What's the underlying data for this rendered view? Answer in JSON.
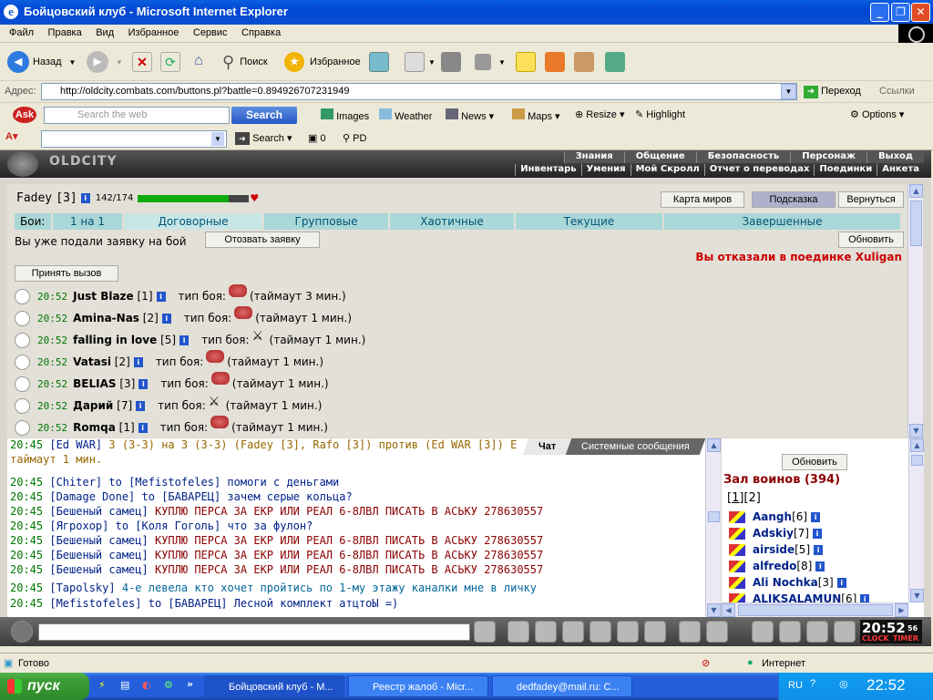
{
  "window": {
    "title": "Бойцовский клуб - Microsoft Internet Explorer"
  },
  "menu": [
    "Файл",
    "Правка",
    "Вид",
    "Избранное",
    "Сервис",
    "Справка"
  ],
  "toolbar": {
    "back": "Назад",
    "search": "Поиск",
    "favorites": "Избранное"
  },
  "address": {
    "label": "Адрес:",
    "url": "http://oldcity.combats.com/buttons.pl?battle=0.894926707231949",
    "go": "Переход",
    "links": "Ссылки"
  },
  "ask": {
    "placeholder": "Search the web",
    "search_btn": "Search",
    "images": "Images",
    "weather": "Weather",
    "news": "News",
    "maps": "Maps",
    "resize": "Resize",
    "highlight": "Highlight",
    "options": "Options",
    "search2": "Search",
    "count": "0",
    "pd": "PD"
  },
  "game": {
    "logo": "OLDCITY",
    "nav_top": [
      "Знания",
      "Общение",
      "Безопасность",
      "Персонаж",
      "Выход"
    ],
    "nav_bottom": [
      "Инвентарь",
      "Умения",
      "Мой Скролл",
      "Отчет о переводах",
      "Поединки",
      "Анкета"
    ],
    "player": {
      "name": "Fadey",
      "level": "[3]",
      "hp": "142/174",
      "hp_fraction": 0.816
    },
    "buttons": {
      "map": "Карта миров",
      "hint": "Подсказка",
      "back": "Вернуться",
      "refresh": "Обновить",
      "withdraw": "Отозвать заявку",
      "accept": "Принять вызов"
    },
    "tabs_label": "Бои:",
    "tabs": [
      "1 на 1",
      "Договорные",
      "Групповые",
      "Хаотичные",
      "Текущие",
      "Завершенные"
    ],
    "submitted": "Вы уже подали заявку на бой",
    "refused": "Вы отказали в поединке Xuligan",
    "fights": [
      {
        "time": "20:52",
        "name": "Just Blaze",
        "level": "[1]",
        "label": "тип боя:",
        "icon": "fist",
        "timeout": "(таймаут 3 мин.)"
      },
      {
        "time": "20:52",
        "name": "Amina-Nas",
        "level": "[2]",
        "label": "тип боя:",
        "icon": "fist",
        "timeout": "(таймаут 1 мин.)"
      },
      {
        "time": "20:52",
        "name": "falling in love",
        "level": "[5]",
        "label": "тип боя:",
        "icon": "swords",
        "timeout": "(таймаут 1 мин.)"
      },
      {
        "time": "20:52",
        "name": "Vatasi",
        "level": "[2]",
        "label": "тип боя:",
        "icon": "fist",
        "timeout": "(таймаут 1 мин.)"
      },
      {
        "time": "20:52",
        "name": "BELIAS",
        "level": "[3]",
        "label": "тип боя:",
        "icon": "fist",
        "timeout": "(таймаут 1 мин.)"
      },
      {
        "time": "20:52",
        "name": "Дарий",
        "level": "[7]",
        "label": "тип боя:",
        "icon": "swords",
        "timeout": "(таймаут 1 мин.)"
      },
      {
        "time": "20:52",
        "name": "Romqa",
        "level": "[1]",
        "label": "тип боя:",
        "icon": "fist",
        "timeout": "(таймаут 1 мин.)"
      }
    ]
  },
  "chat": {
    "tabs": [
      "Чат",
      "Системные сообщения"
    ],
    "lines": [
      {
        "time": "20:45",
        "name": "[Ed WAR]",
        "text": "3 (3-3) на 3 (3-3) (Fadey [3], Rafo [3]) против (Ed WAR [3]) E"
      },
      {
        "time": "",
        "name": "",
        "text": "таймаут 1 мин."
      },
      {
        "time": "20:45",
        "name": "[Chiter]",
        "text": "to [Mefistofeles] помоги с деньгами"
      },
      {
        "time": "20:45",
        "name": "[Damage Done]",
        "text": "to [БАВАРЕЦ] зачем серые кольца?"
      },
      {
        "time": "20:45",
        "name": "[Бешеный самец]",
        "text": "КУПЛЮ ПЕРСА ЗА ЕКР ИЛИ РЕАЛ 6-8ЛВЛ ПИСАТЬ В АСЬКУ 278630557"
      },
      {
        "time": "20:45",
        "name": "[Ягрохор]",
        "text": "to [Коля Гоголь] что за фулон?"
      },
      {
        "time": "20:45",
        "name": "[Бешеный самец]",
        "text": "КУПЛЮ ПЕРСА ЗА ЕКР ИЛИ РЕАЛ 6-8ЛВЛ ПИСАТЬ В АСЬКУ 278630557"
      },
      {
        "time": "20:45",
        "name": "[Бешеный самец]",
        "text": "КУПЛЮ ПЕРСА ЗА ЕКР ИЛИ РЕАЛ 6-8ЛВЛ ПИСАТЬ В АСЬКУ 278630557"
      },
      {
        "time": "20:45",
        "name": "[Бешеный самец]",
        "text": "КУПЛЮ ПЕРСА ЗА ЕКР ИЛИ РЕАЛ 6-8ЛВЛ ПИСАТЬ В АСЬКУ 278630557"
      },
      {
        "time": "20:45",
        "name": "[Tapolsky]",
        "text": "4-е левела кто хочет пройтись по 1-му этажу каналки мне в личку"
      },
      {
        "time": "20:45",
        "name": "[Mefistofeles]",
        "text": "to [БАВАРЕЦ] Лесной комплект атцтоЫ =)"
      }
    ]
  },
  "room": {
    "refresh": "Обновить",
    "title": "Зал воинов (394)",
    "pages": [
      "[1]",
      "[2]"
    ],
    "users": [
      {
        "name": "Aangh",
        "level": "[6]"
      },
      {
        "name": "Adskiy",
        "level": "[7]"
      },
      {
        "name": "airside",
        "level": "[5]"
      },
      {
        "name": "alfredo",
        "level": "[8]"
      },
      {
        "name": "Ali Nochka",
        "level": "[3]"
      },
      {
        "name": "ALIKSALAMUN",
        "level": "[6]"
      }
    ]
  },
  "clock": {
    "time": "20:52",
    "sec": "56",
    "clock_lbl": "CLOCK",
    "timer_lbl": "TIMER"
  },
  "status": {
    "ready": "Готово",
    "zone": "Интернет"
  },
  "taskbar": {
    "start": "пуск",
    "tasks": [
      "Бойцовский клуб - M...",
      "Реестр жалоб - Micr...",
      "dedfadey@mail.ru: C..."
    ],
    "lang": "RU",
    "time": "22:52"
  }
}
